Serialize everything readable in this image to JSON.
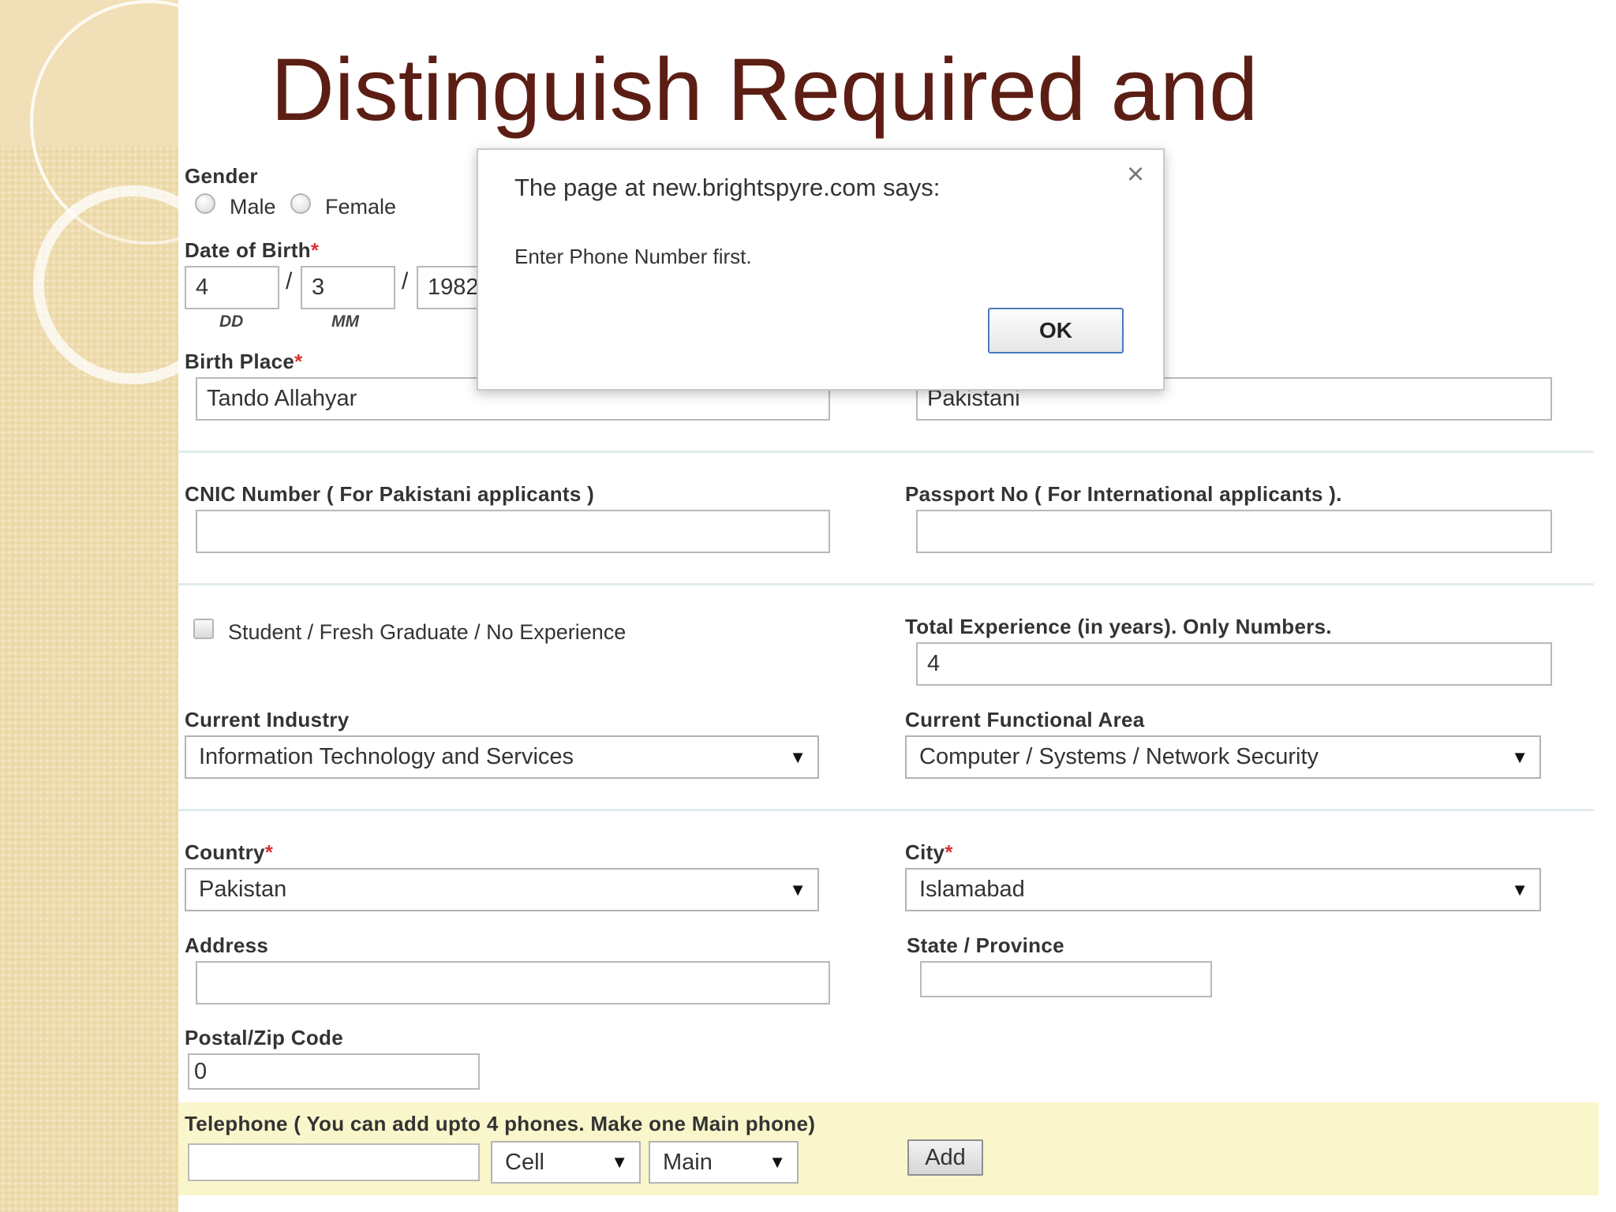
{
  "slide": {
    "title": "Distinguish Required and"
  },
  "gender": {
    "label": "Gender",
    "options": [
      "Male",
      "Female"
    ]
  },
  "dob": {
    "label": "Date of Birth",
    "required_mark": "*",
    "day": "4",
    "month": "3",
    "year": "1982",
    "day_hint": "DD",
    "month_hint": "MM",
    "separator": "/"
  },
  "birth_place": {
    "label": "Birth Place",
    "required_mark": "*",
    "value": "Tando Allahyar"
  },
  "nationality": {
    "value": "Pakistani"
  },
  "cnic": {
    "label": "CNIC Number ( For Pakistani applicants )",
    "value": ""
  },
  "passport": {
    "label": "Passport No ( For International applicants ).",
    "value": ""
  },
  "student_checkbox": {
    "label": "Student / Fresh Graduate / No Experience"
  },
  "experience": {
    "label": "Total Experience (in years). Only Numbers.",
    "value": "4"
  },
  "industry": {
    "label": "Current Industry",
    "selected": "Information Technology and Services"
  },
  "functional_area": {
    "label": "Current Functional Area",
    "selected": "Computer / Systems / Network Security"
  },
  "country": {
    "label": "Country",
    "required_mark": "*",
    "selected": "Pakistan"
  },
  "city": {
    "label": "City",
    "required_mark": "*",
    "selected": "Islamabad"
  },
  "address": {
    "label": "Address",
    "value": ""
  },
  "state": {
    "label": "State / Province",
    "value": ""
  },
  "postal": {
    "label": "Postal/Zip Code",
    "value": "0"
  },
  "telephone": {
    "label": "Telephone ( You can add upto 4 phones. Make one Main phone)",
    "number": "",
    "type_selected": "Cell",
    "priority_selected": "Main",
    "add_label": "Add"
  },
  "dialog": {
    "title": "The page at new.brightspyre.com says:",
    "message": "Enter Phone Number first.",
    "ok_label": "OK",
    "close_glyph": "×"
  },
  "glyphs": {
    "dropdown_arrow": "▼"
  },
  "colors": {
    "title": "#5c1e14",
    "required": "#d33333",
    "telephone_band": "#faf6cc",
    "side_panel": "#efdcae",
    "ok_border": "#4a7bbd"
  }
}
